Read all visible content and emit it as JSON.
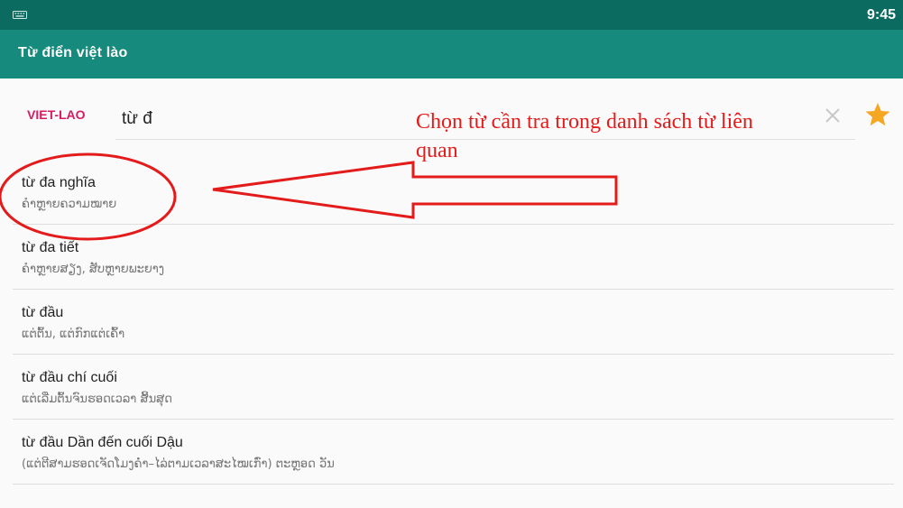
{
  "status_bar": {
    "time": "9:45",
    "keyboard_icon": "keyboard-icon"
  },
  "app_bar": {
    "title": "Từ điển việt lào"
  },
  "search": {
    "language": "VIET-LAO",
    "query": "từ đ",
    "clear_icon": "close-icon",
    "favorite_icon": "star-icon"
  },
  "results": [
    {
      "word": "từ đa nghĩa",
      "meaning": "ຄຳຫຼາຍຄວາມໝາຍ"
    },
    {
      "word": "từ đa tiết",
      "meaning": "ຄຳຫຼາຍສຽງ, ສັບຫຼາຍພະຍາງ"
    },
    {
      "word": "từ đầu",
      "meaning": "ແຕ່ຕົ້ນ, ແຕ່ກົກແຕ່ເຄົ້າ"
    },
    {
      "word": "từ đầu chí cuối",
      "meaning": "ແຕ່ເລີ່ມຕົ້ນຈົນຮອດເວລາ ສິ້ນສຸດ"
    },
    {
      "word": "từ đầu Dần đến cuối Dậu",
      "meaning": "(ແຕ່ຕີສາມຮອດເຈັດໂມງຄ່ຳ–ໄລ່ຕາມເວລາສະໄໝເກົ່າ) ຕະຫຼອດ ວັນ"
    }
  ],
  "annotation": {
    "text": "Chọn từ cần tra trong danh sách từ liên quan",
    "color": "#e31b1b"
  },
  "colors": {
    "status_bar": "#0c6b60",
    "app_bar": "#168a7c",
    "accent": "#d81b60",
    "star": "#f5a623"
  }
}
